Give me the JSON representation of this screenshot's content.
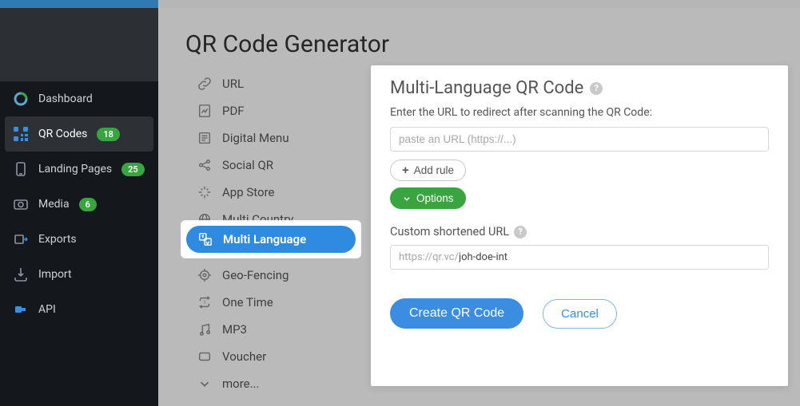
{
  "sidebar": {
    "items": [
      {
        "label": "Dashboard",
        "badge": null,
        "active": false
      },
      {
        "label": "QR Codes",
        "badge": "18",
        "active": true
      },
      {
        "label": "Landing Pages",
        "badge": "25",
        "active": false
      },
      {
        "label": "Media",
        "badge": "6",
        "active": false
      },
      {
        "label": "Exports",
        "badge": null,
        "active": false
      },
      {
        "label": "Import",
        "badge": null,
        "active": false
      },
      {
        "label": "API",
        "badge": null,
        "active": false
      }
    ]
  },
  "page": {
    "title": "QR Code Generator"
  },
  "types": {
    "items": [
      "URL",
      "PDF",
      "Digital Menu",
      "Social QR",
      "App Store",
      "Multi Country",
      "Multi Language",
      "Geo-Fencing",
      "One Time",
      "MP3",
      "Voucher",
      "more..."
    ],
    "active_index": 6
  },
  "panel": {
    "title": "Multi-Language QR Code",
    "subtitle": "Enter the URL to redirect after scanning the QR Code:",
    "url_placeholder": "paste an URL (https://...)",
    "add_rule_label": "Add rule",
    "options_label": "Options",
    "short_url_label": "Custom shortened URL",
    "short_url_prefix": "https://qr.vc/",
    "short_url_value": "joh-doe-int",
    "primary_btn": "Create QR Code",
    "secondary_btn": "Cancel"
  }
}
